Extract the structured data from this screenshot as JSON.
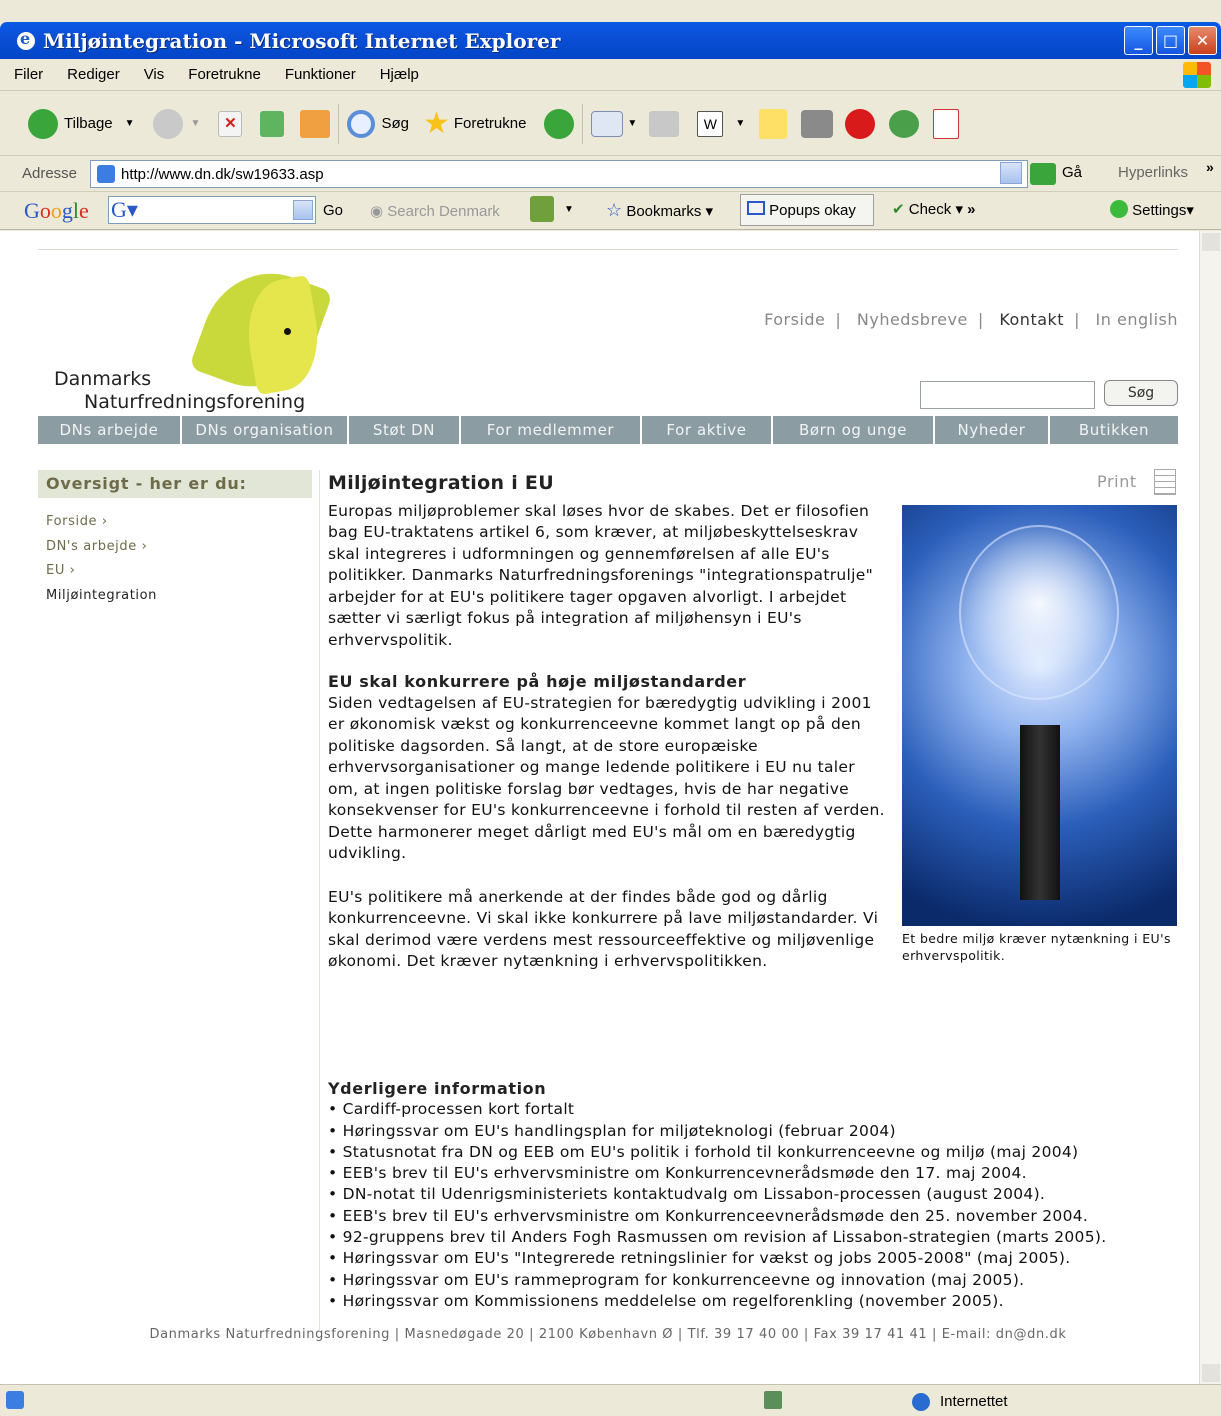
{
  "window": {
    "title": "Miljøintegration - Microsoft Internet Explorer"
  },
  "menu": [
    "Filer",
    "Rediger",
    "Vis",
    "Foretrukne",
    "Funktioner",
    "Hjælp"
  ],
  "toolbar": {
    "back": "Tilbage",
    "search": "Søg",
    "favorites": "Foretrukne"
  },
  "address": {
    "label": "Adresse",
    "url": "http://www.dn.dk/sw19633.asp",
    "go": "Gå",
    "links": "Hyperlinks"
  },
  "googlebar": {
    "logo": "Google",
    "go": "Go",
    "search_site": "Search Denmark",
    "bookmarks": "Bookmarks",
    "popups": "Popups okay",
    "check": "Check",
    "settings": "Settings"
  },
  "site": {
    "logo_line1": "Danmarks",
    "logo_line2": "Naturfredningsforening",
    "toplinks": [
      "Forside",
      "Nyhedsbreve",
      "Kontakt",
      "In english"
    ],
    "search_button": "Søg",
    "nav": [
      "DNs arbejde",
      "DNs organisation",
      "Støt DN",
      "For medlemmer",
      "For aktive",
      "Børn og unge",
      "Nyheder",
      "Butikken"
    ],
    "sidebar_title": "Oversigt - her er du:",
    "breadcrumbs": [
      {
        "label": "Forside ›"
      },
      {
        "label": "DN's arbejde ›"
      },
      {
        "label": "EU ›"
      },
      {
        "label": "Miljøintegration"
      }
    ],
    "print": "Print",
    "article_title": "Miljøintegration i EU",
    "intro": "Europas miljøproblemer skal løses hvor de skabes. Det er filosofien bag EU-traktatens artikel 6, som kræver, at miljøbeskyttelseskrav skal integreres i udformningen og gennemførelsen af alle EU's politikker. Danmarks Naturfredningsforenings \"integrationspatrulje\" arbejder for at EU's politikere tager opgaven alvorligt. I arbejdet sætter vi særligt fokus på integration af miljøhensyn i EU's erhvervspolitik.",
    "subheading": "EU skal konkurrere på høje miljøstandarder",
    "para2": "Siden vedtagelsen af EU-strategien for bæredygtig udvikling i 2001 er økonomisk vækst og konkurrenceevne kommet langt op på den politiske dagsorden. Så langt, at de store europæiske erhvervsorganisationer og mange ledende politikere i EU nu taler om, at ingen politiske forslag bør vedtages, hvis de har negative konsekvenser for EU's konkurrenceevne i forhold til resten af verden. Dette harmonerer meget dårligt med EU's mål om en bæredygtig udvikling.",
    "para3": "EU's politikere må anerkende at der findes både god og dårlig konkurrenceevne. Vi skal ikke konkurrere på lave miljøstandarder. Vi skal derimod være verdens mest ressourceeffektive og miljøvenlige økonomi. Det kræver nytænkning i erhvervspolitikken.",
    "caption": "Et bedre miljø kræver nytænkning i EU's erhvervspolitik.",
    "more_title": "Yderligere information",
    "more_links": [
      "• Cardiff-processen kort fortalt",
      "• Høringssvar om EU's handlingsplan for miljøteknologi (februar 2004)",
      "• Statusnotat fra DN og EEB om EU's politik i forhold til konkurrenceevne og miljø (maj 2004)",
      "• EEB's brev til EU's erhvervsministre om Konkurrencevnerådsmøde den 17. maj 2004.",
      "• DN-notat til Udenrigsministeriets kontaktudvalg om Lissabon-processen (august 2004).",
      "• EEB's brev til EU's erhvervsministre om Konkurrenceevnerådsmøde den 25. november 2004.",
      "• 92-gruppens brev til Anders Fogh Rasmussen om revision af Lissabon-strategien (marts 2005).",
      "• Høringssvar om EU's \"Integrerede retningslinier for vækst og jobs 2005-2008\" (maj 2005).",
      "• Høringssvar om EU's rammeprogram for konkurrenceevne og innovation (maj 2005).",
      "• Høringssvar om Kommissionens meddelelse om regelforenkling (november 2005)."
    ],
    "footer": "Danmarks Naturfredningsforening  |  Masnedøgade 20  |  2100 København Ø  |  Tlf. 39 17 40 00  |  Fax 39 17 41 41  |  E-mail: dn@dn.dk"
  },
  "status": {
    "zone": "Internettet"
  }
}
